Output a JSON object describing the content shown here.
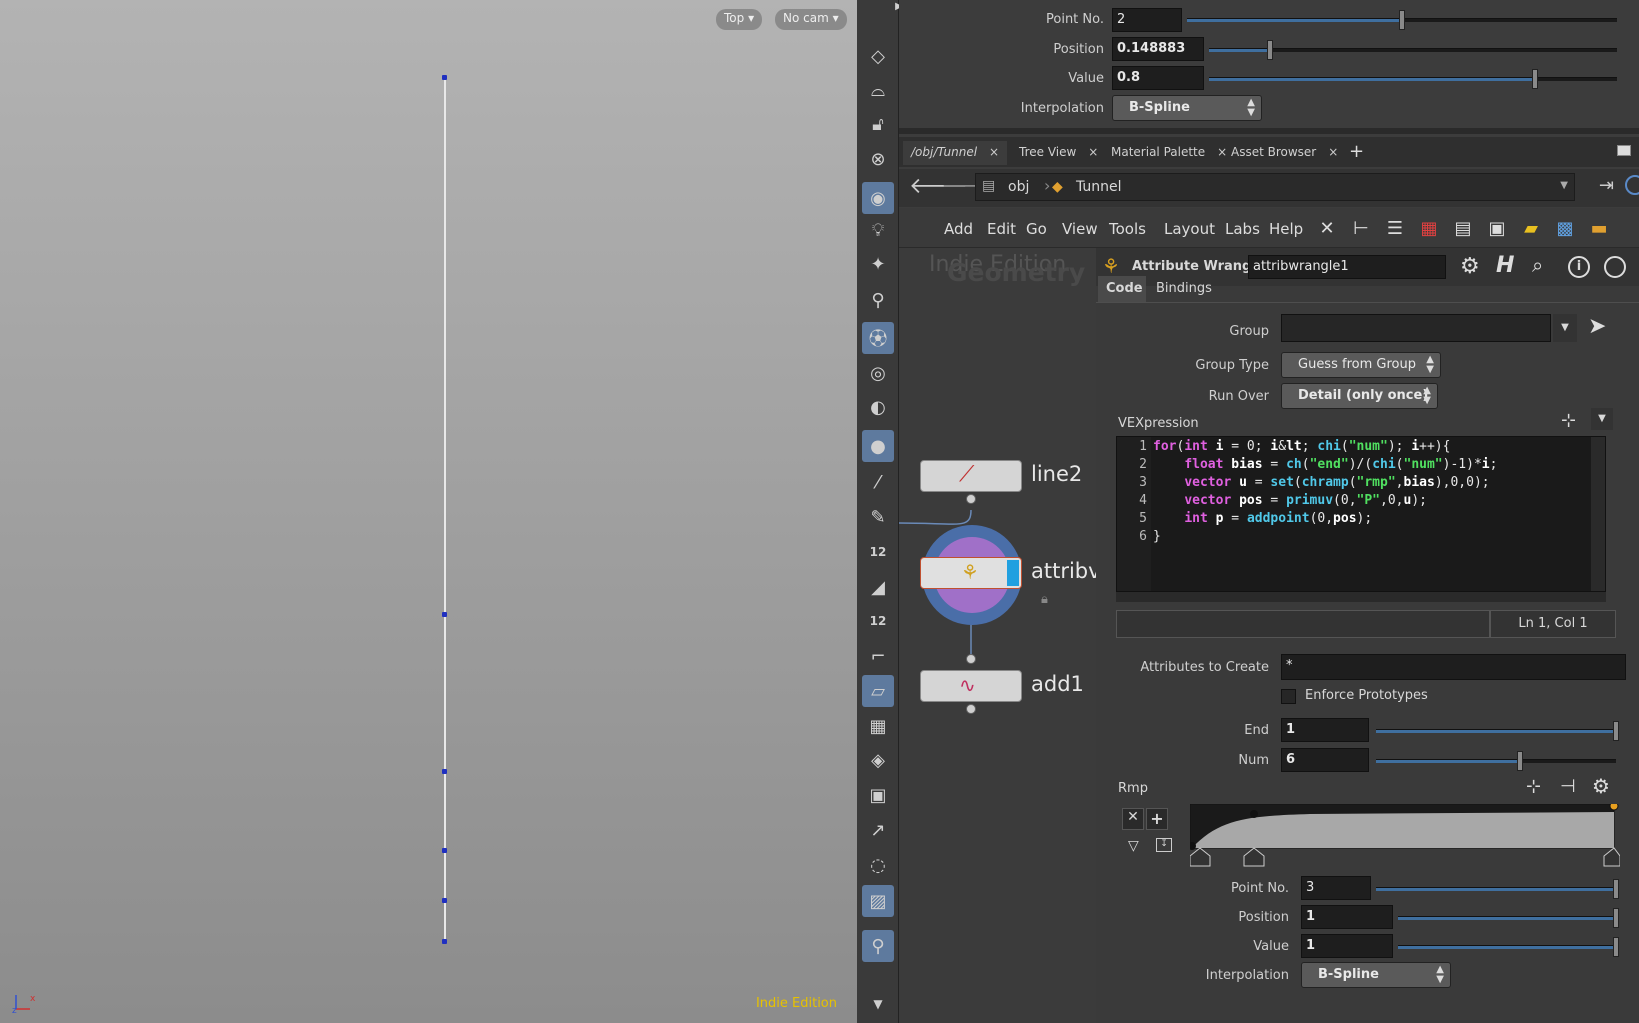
{
  "viewport": {
    "view_label": "Top",
    "cam_label": "No cam",
    "edition": "Indie Edition",
    "axis_x": "x",
    "axis_z": "z"
  },
  "shelf": {
    "icons": [
      "box-icon",
      "curve-icon",
      "lock-icon",
      "close-circle-icon",
      "light-icon",
      "handle-icon",
      "bulb-icon",
      "bulb-plus-icon",
      "light-add-icon",
      "ball-icon",
      "eye-icon",
      "eye2-icon",
      "point-icon",
      "brush-icon",
      "pen-icon",
      "12",
      "paint-icon",
      "12",
      "curve-tool-icon",
      "poly-icon",
      "checker-icon",
      "snap-icon",
      "green-box-icon",
      "arrow-tool-icon",
      "ring-icon",
      "image-icon",
      "pin-icon",
      "arrow-down-icon"
    ],
    "label_12a": "12",
    "label_12b": "12"
  },
  "top_parms": {
    "point_no_label": "Point No.",
    "point_no_value": "2",
    "point_no_slider": 0.5,
    "position_label": "Position",
    "position_value": "0.148883",
    "position_slider": 0.148883,
    "value_label": "Value",
    "value_value": "0.8",
    "value_slider": 0.8,
    "interp_label": "Interpolation",
    "interp_value": "B-Spline"
  },
  "tabs": [
    {
      "label": "/obj/Tunnel"
    },
    {
      "label": "Tree View"
    },
    {
      "label": "Material Palette"
    },
    {
      "label": "Asset Browser"
    }
  ],
  "tab_close": "×",
  "tab_add": "+",
  "path": {
    "obj": "obj",
    "tunnel": "Tunnel"
  },
  "menu": [
    "Add",
    "Edit",
    "Go",
    "View",
    "Tools",
    "Layout",
    "Labs",
    "Help"
  ],
  "network": {
    "watermark1": "Indie Edition",
    "watermark2": "Geometry",
    "nodes": {
      "line": "line2",
      "wrangle": "attribv",
      "add": "add1"
    }
  },
  "parm": {
    "node_type": "Attribute Wrangle",
    "node_name": "attribwrangle1",
    "tabs": [
      "Code",
      "Bindings"
    ],
    "group_label": "Group",
    "group_value": "",
    "group_type_label": "Group Type",
    "group_type_value": "Guess from Group",
    "run_over_label": "Run Over",
    "run_over_value": "Detail (only once)",
    "vex_label": "VEXpression",
    "code_lines": [
      "for(int i = 0; i< chi(\"num\"); i++){",
      "    float bias = ch(\"end\")/(chi(\"num\")-1)*i;",
      "    vector u = set(chramp(\"rmp\",bias),0,0);",
      "    vector pos = primuv(0,\"P\",0,u);",
      "    int p = addpoint(0,pos);",
      "}"
    ],
    "cursor_pos": "Ln 1, Col 1",
    "attrs_label": "Attributes to Create",
    "attrs_value": "*",
    "enforce_label": "Enforce Prototypes",
    "end_label": "End",
    "end_value": "1",
    "end_slider": 1.0,
    "num_label": "Num",
    "num_value": "6",
    "num_slider": 0.6,
    "rmp_label": "Rmp",
    "ramp_point_no_label": "Point No.",
    "ramp_point_no_value": "3",
    "ramp_point_no_slider": 1.0,
    "ramp_position_label": "Position",
    "ramp_position_value": "1",
    "ramp_position_slider": 1.0,
    "ramp_value_label": "Value",
    "ramp_value_value": "1",
    "ramp_value_slider": 1.0,
    "ramp_interp_label": "Interpolation",
    "ramp_interp_value": "B-Spline"
  }
}
